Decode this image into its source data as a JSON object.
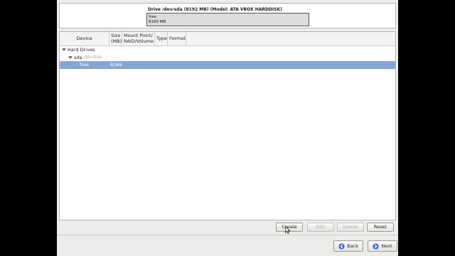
{
  "drive": {
    "title": "Drive /dev/sda (8192 MB) (Model: ATA VBOX HARDDISK)",
    "bar_label": "free",
    "bar_size": "8189 MB"
  },
  "columns": {
    "device": "Device",
    "size": "Size (MB)",
    "mount": "Mount Point/ RAID/Volume",
    "type": "Type",
    "format": "Format"
  },
  "tree": {
    "group": "Hard Drives",
    "disk": "sda",
    "disk_path": "/dev/sda",
    "free_label": "free",
    "free_size": "8189"
  },
  "buttons": {
    "create": "Create",
    "edit": "Edit",
    "delete": "Delete",
    "reset": "Reset",
    "back": "Back",
    "next": "Next"
  },
  "colors": {
    "selection": "#84a6d6",
    "arrow": "#3a6bc4"
  }
}
